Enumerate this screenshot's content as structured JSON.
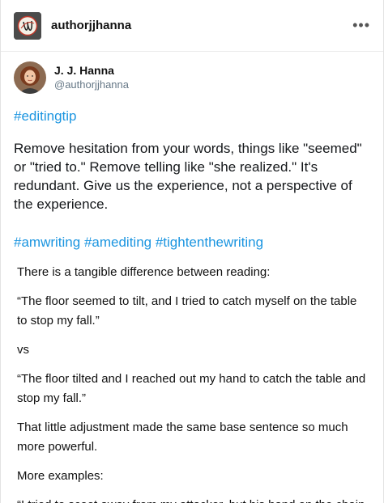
{
  "header": {
    "blog_name": "authorjjhanna",
    "more_label": "•••"
  },
  "tweet": {
    "display_name": "J. J. Hanna",
    "handle": "@authorjjhanna",
    "hashtag_top": "#editingtip",
    "text": "Remove hesitation from your words, things like \"seemed\" or \"tried to.\" Remove telling like \"she realized.\" It's redundant. Give us the experience, not a perspective of the experience.",
    "hashtags": [
      "#amwriting",
      "#amediting",
      "#tightenthewriting"
    ]
  },
  "post": {
    "paragraphs": [
      "There is a tangible difference between reading:",
      "“The floor seemed to tilt, and I tried to catch myself on the table to stop my fall.”",
      "vs",
      "“The floor tilted and I reached out my hand to catch the table and stop my fall.”",
      "That little adjustment made the same base sentence so much more powerful.",
      "More examples:",
      "“I tried to scoot away from my attacker, but his hand on the chain"
    ]
  },
  "icons": {
    "blog_avatar": "monogram-logo-icon",
    "tweet_avatar": "profile-photo",
    "more": "ellipsis-icon"
  },
  "colors": {
    "hashtag": "#1b95e0",
    "handle": "#657786"
  }
}
